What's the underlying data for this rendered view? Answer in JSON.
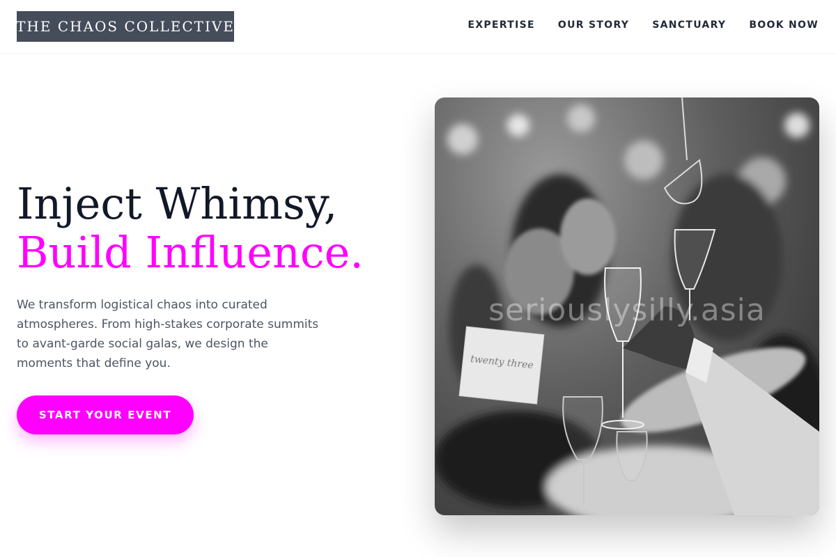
{
  "brand": {
    "name": "THE CHAOS COLLECTIVE"
  },
  "nav": {
    "items": [
      {
        "label": "EXPERTISE"
      },
      {
        "label": "OUR STORY"
      },
      {
        "label": "SANCTUARY"
      },
      {
        "label": "BOOK NOW"
      }
    ]
  },
  "hero": {
    "headline_line1": "Inject Whimsy,",
    "headline_line2": "Build Influence.",
    "lead": "We transform logistical chaos into curated atmospheres. From high-stakes corporate summits to avant-garde social galas, we design the moments that define you.",
    "cta_label": "START YOUR EVENT",
    "image_watermark": "seriouslysilly.asia",
    "table_card_text": "twenty three"
  },
  "colors": {
    "accent": "#ff00ff",
    "logo_bg": "#454d5b",
    "heading": "#111827",
    "body_text": "#4b5563"
  }
}
